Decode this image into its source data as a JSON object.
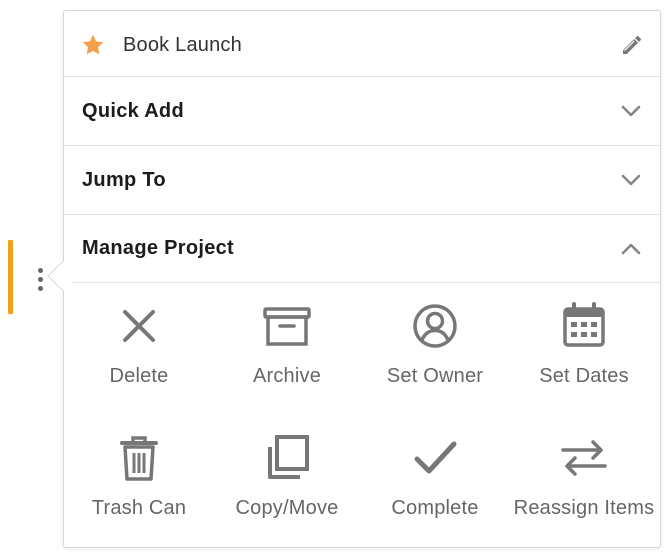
{
  "project": {
    "name": "Book Launch",
    "star_icon": "star-icon",
    "edit_icon": "pencil-icon"
  },
  "sections": [
    {
      "label": "Quick Add",
      "expanded": false,
      "icon": "chevron-down-icon"
    },
    {
      "label": "Jump To",
      "expanded": false,
      "icon": "chevron-down-icon"
    },
    {
      "label": "Manage Project",
      "expanded": true,
      "icon": "chevron-up-icon"
    }
  ],
  "actions": [
    {
      "label": "Delete",
      "icon": "x-icon"
    },
    {
      "label": "Archive",
      "icon": "archive-box-icon"
    },
    {
      "label": "Set Owner",
      "icon": "user-circle-icon"
    },
    {
      "label": "Set Dates",
      "icon": "calendar-icon"
    },
    {
      "label": "Trash Can",
      "icon": "trash-icon"
    },
    {
      "label": "Copy/Move",
      "icon": "copy-icon"
    },
    {
      "label": "Complete",
      "icon": "checkmark-icon"
    },
    {
      "label": "Reassign Items",
      "icon": "swap-arrows-icon"
    }
  ],
  "colors": {
    "accent": "#f0a31a",
    "star": "#f6a04d",
    "icon": "#777777",
    "border": "#d6d6dc"
  }
}
